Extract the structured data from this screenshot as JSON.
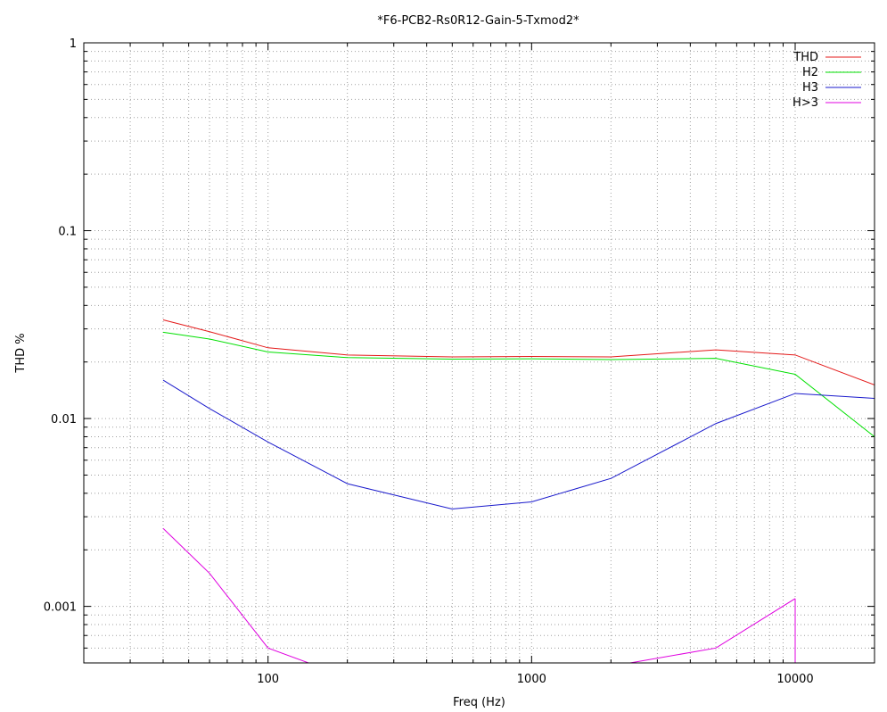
{
  "chart_data": {
    "type": "line",
    "title": "*F6-PCB2-Rs0R12-Gain-5-Txmod2*",
    "xlabel": "Freq (Hz)",
    "ylabel": "THD %",
    "xscale": "log",
    "yscale": "log",
    "xlim": [
      20,
      20000
    ],
    "ylim": [
      0.0005,
      1
    ],
    "grid": true,
    "legend_position": "top-right",
    "x_tick_labels": [
      "100",
      "1000",
      "10000"
    ],
    "y_tick_labels": [
      "0.001",
      "0.01",
      "0.1",
      "1"
    ],
    "x": [
      40,
      60,
      100,
      200,
      500,
      1000,
      2000,
      5000,
      10000,
      20000
    ],
    "series": [
      {
        "name": "THD",
        "color": "#e41a1a",
        "values": [
          0.0335,
          0.029,
          0.0238,
          0.0218,
          0.0213,
          0.0214,
          0.0213,
          0.0232,
          0.0218,
          0.0151
        ]
      },
      {
        "name": "H2",
        "color": "#00e000",
        "values": [
          0.0288,
          0.0265,
          0.0226,
          0.0211,
          0.0207,
          0.0208,
          0.0206,
          0.0209,
          0.0172,
          0.008
        ]
      },
      {
        "name": "H3",
        "color": "#1a1acc",
        "values": [
          0.016,
          0.0113,
          0.0075,
          0.0045,
          0.0033,
          0.0036,
          0.0048,
          0.0094,
          0.0136,
          0.0128
        ]
      },
      {
        "name": "H>3",
        "color": "#e000e0",
        "values": [
          0.0026,
          0.0015,
          0.0006,
          0.00042,
          null,
          null,
          0.00048,
          0.0006,
          0.0011,
          null
        ]
      }
    ]
  }
}
